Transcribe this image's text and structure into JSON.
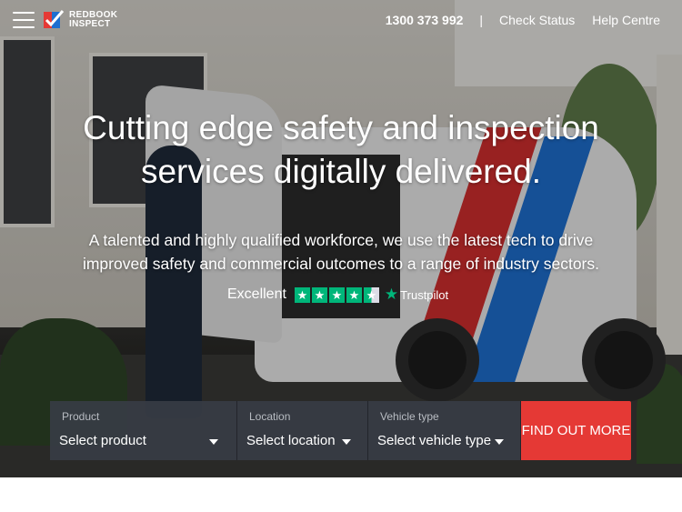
{
  "header": {
    "logo_line1": "REDBOOK",
    "logo_line2": "INSPECT",
    "phone": "1300 373 992",
    "separator": "|",
    "check_status": "Check Status",
    "help_centre": "Help Centre"
  },
  "hero": {
    "headline_line1": "Cutting edge safety and inspection",
    "headline_line2": "services digitally delivered.",
    "subtext_line1": "A talented and highly qualified workforce, we use the latest tech to drive",
    "subtext_line2": "improved safety and commercial outcomes to a range of industry sectors.",
    "rating_label": "Excellent",
    "rating_stars": 4.5,
    "trustpilot": "Trustpilot"
  },
  "search": {
    "product_label": "Product",
    "product_value": "Select product",
    "location_label": "Location",
    "location_value": "Select location",
    "vehicle_label": "Vehicle type",
    "vehicle_value": "Select vehicle type",
    "button_label": "FIND OUT MORE"
  },
  "colors": {
    "accent_red": "#e53935",
    "trustpilot_green": "#00b67a",
    "field_bg": "#373c44"
  },
  "icons": {
    "menu": "hamburger-icon",
    "logo": "redbook-check-logo-icon",
    "dropdown": "caret-down-icon",
    "trustpilot": "star-icon"
  }
}
